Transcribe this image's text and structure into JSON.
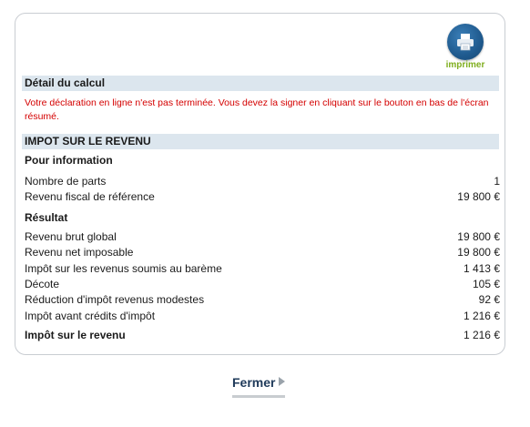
{
  "print": {
    "label": "imprimer",
    "icon": "printer-icon"
  },
  "detail": {
    "title": "Détail du calcul",
    "warning": "Votre déclaration en ligne n'est pas terminée. Vous devez la signer en cliquant sur le bouton en bas de l'écran résumé."
  },
  "impot": {
    "title": "IMPOT SUR LE REVENU",
    "info_heading": "Pour information",
    "info_rows": [
      {
        "label": "Nombre de parts",
        "value": "1"
      },
      {
        "label": "Revenu fiscal de référence",
        "value": "19 800 €"
      }
    ],
    "result_heading": "Résultat",
    "result_rows": [
      {
        "label": "Revenu brut global",
        "value": "19 800 €"
      },
      {
        "label": "Revenu net imposable",
        "value": "19 800 €"
      },
      {
        "label": "Impôt sur les revenus soumis au barème",
        "value": "1 413 €"
      },
      {
        "label": "Décote",
        "value": "105 €"
      },
      {
        "label": "Réduction d'impôt revenus modestes",
        "value": "92 €"
      },
      {
        "label": "Impôt avant crédits d'impôt",
        "value": "1 216 €"
      }
    ],
    "total": {
      "label": "Impôt sur le revenu",
      "value": "1 216 €"
    }
  },
  "footer": {
    "close_label": "Fermer"
  }
}
